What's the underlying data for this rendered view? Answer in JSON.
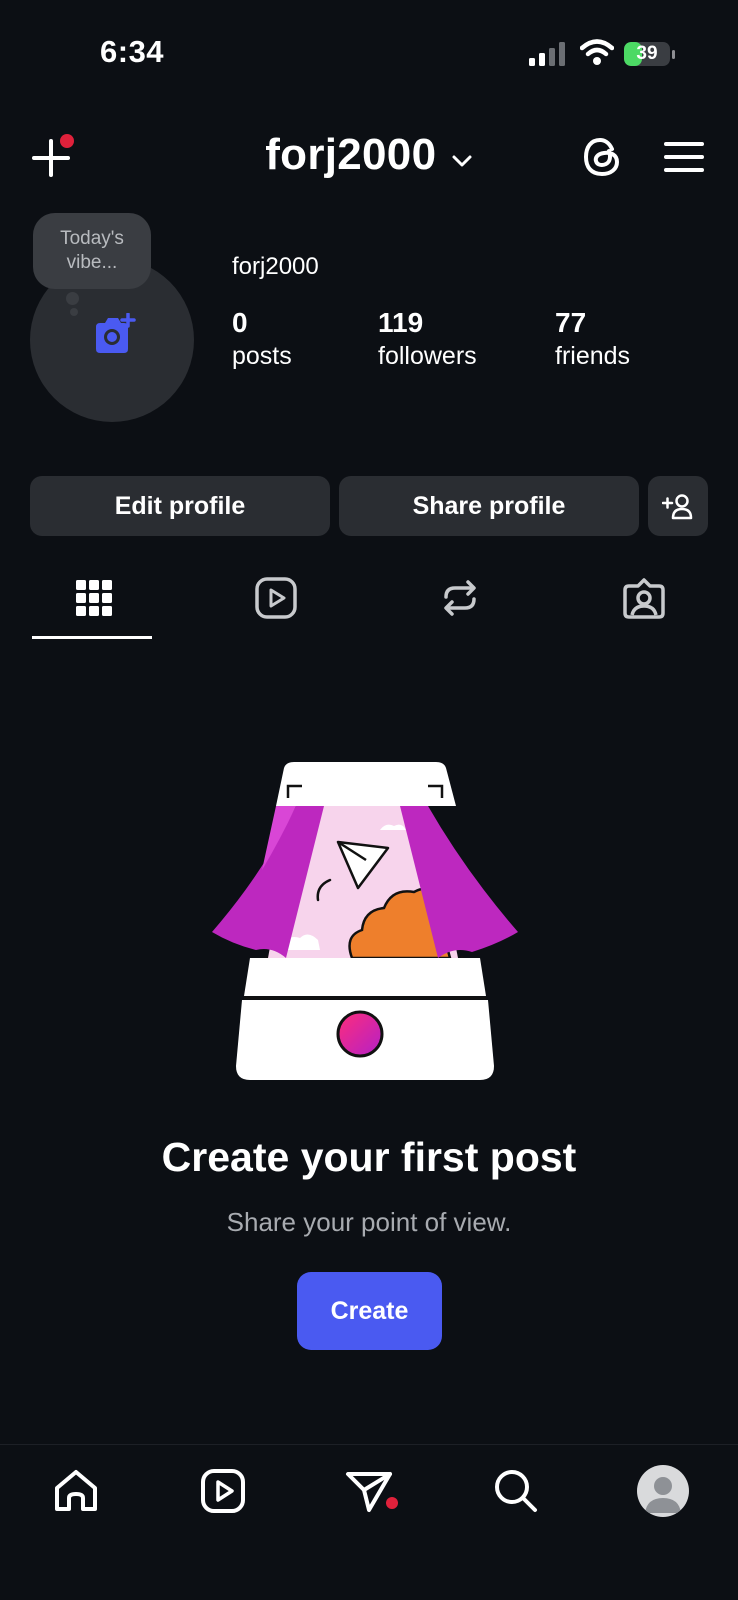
{
  "status_bar": {
    "time": "6:34",
    "battery_percent": "39",
    "battery_level": 0.39,
    "icons": [
      "signal-icon",
      "wifi-icon",
      "battery-charging-icon"
    ]
  },
  "header": {
    "username": "forj2000",
    "icons": [
      "plus-icon",
      "chevron-down-icon",
      "threads-icon",
      "menu-icon"
    ],
    "notification_dot_color": "#e0213b"
  },
  "profile": {
    "note_bubble": "Today's vibe...",
    "display_name": "forj2000",
    "stats": [
      {
        "value": "0",
        "label": "posts"
      },
      {
        "value": "119",
        "label": "followers"
      },
      {
        "value": "77",
        "label": "friends"
      }
    ],
    "avatar_icon": "add-photo-camera-icon",
    "accent_color": "#4a5af1"
  },
  "actions": {
    "edit_label": "Edit profile",
    "share_label": "Share profile",
    "add_friend_icon": "add-person-icon"
  },
  "tabs": [
    {
      "icon": "grid-icon",
      "active": true
    },
    {
      "icon": "reels-icon",
      "active": false
    },
    {
      "icon": "reposts-icon",
      "active": false
    },
    {
      "icon": "tagged-icon",
      "active": false
    }
  ],
  "empty_state": {
    "illustration": "photo-booth-illustration",
    "title": "Create your first post",
    "subtitle": "Share your point of view.",
    "button_label": "Create"
  },
  "bottom_nav": [
    {
      "icon": "home-icon"
    },
    {
      "icon": "reels-icon"
    },
    {
      "icon": "messages-icon",
      "badge_dot": true
    },
    {
      "icon": "search-icon"
    },
    {
      "icon": "profile-avatar-icon",
      "active": true
    }
  ],
  "colors": {
    "background": "#0c0f14",
    "surface": "#2a2d32",
    "primary_button": "#4a5af1",
    "badge": "#e0213b"
  }
}
